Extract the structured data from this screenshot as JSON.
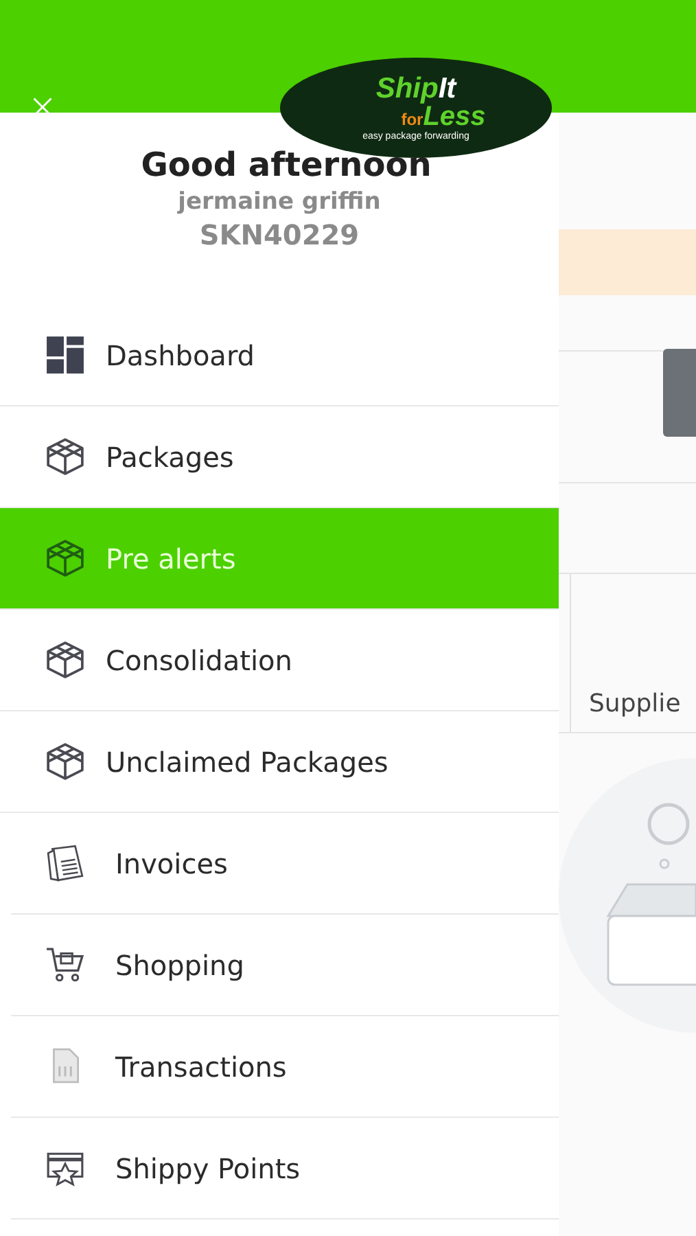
{
  "logo": {
    "ship": "Ship",
    "it": "It",
    "for": "for",
    "less": "Less",
    "tagline": "easy package forwarding"
  },
  "drawer": {
    "greeting": "Good afternoon",
    "user_name": "jermaine griffin",
    "account_id": "SKN40229",
    "items": [
      {
        "label": "Dashboard",
        "kind": "grid",
        "selected": false
      },
      {
        "label": "Packages",
        "kind": "cube",
        "selected": false
      },
      {
        "label": "Pre alerts",
        "kind": "cube",
        "selected": true
      },
      {
        "label": "Consolidation",
        "kind": "cube",
        "selected": false
      },
      {
        "label": "Unclaimed Packages",
        "kind": "cube",
        "selected": false
      },
      {
        "label": "Invoices",
        "kind": "invoice",
        "selected": false
      },
      {
        "label": "Shopping",
        "kind": "cart",
        "selected": false
      },
      {
        "label": "Transactions",
        "kind": "document",
        "selected": false
      },
      {
        "label": "Shippy Points",
        "kind": "points",
        "selected": false
      }
    ]
  },
  "background_page": {
    "column_label": "Supplie"
  }
}
